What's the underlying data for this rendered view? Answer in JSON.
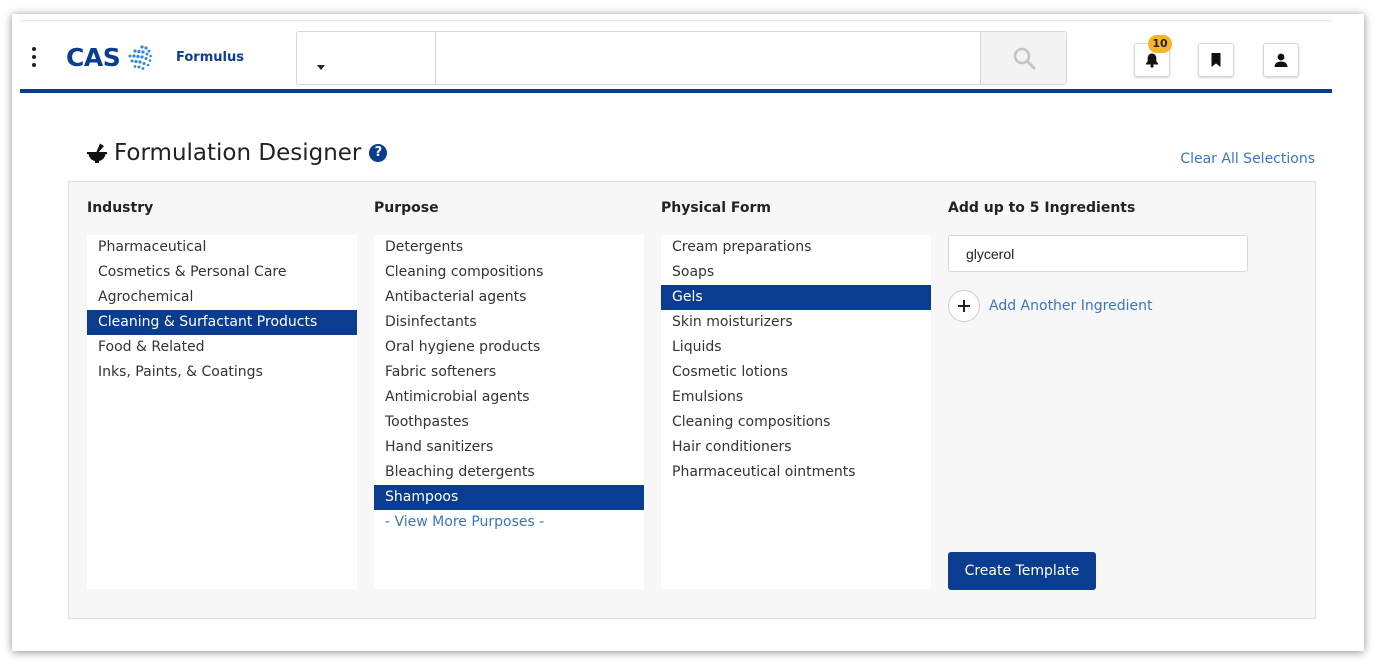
{
  "header": {
    "logo_text": "CAS",
    "product_name": "Formulus",
    "search": {
      "scope_value": "",
      "query": "",
      "placeholder": ""
    },
    "notifications_count": "10",
    "icons": [
      "menu-kebab-icon",
      "search-icon",
      "bell-icon",
      "bookmark-icon",
      "user-icon"
    ],
    "accent_color": "#0a3d8f",
    "badge_color": "#f5b52a"
  },
  "page": {
    "title": "Formulation Designer",
    "help_glyph": "?",
    "clear_all_label": "Clear All Selections"
  },
  "columns": {
    "industry": {
      "heading": "Industry",
      "items": [
        {
          "label": "Pharmaceutical",
          "selected": false
        },
        {
          "label": "Cosmetics & Personal Care",
          "selected": false
        },
        {
          "label": "Agrochemical",
          "selected": false
        },
        {
          "label": "Cleaning & Surfactant Products",
          "selected": true
        },
        {
          "label": "Food & Related",
          "selected": false
        },
        {
          "label": "Inks, Paints, & Coatings",
          "selected": false
        }
      ]
    },
    "purpose": {
      "heading": "Purpose",
      "items": [
        {
          "label": "Detergents",
          "selected": false
        },
        {
          "label": "Cleaning compositions",
          "selected": false
        },
        {
          "label": "Antibacterial agents",
          "selected": false
        },
        {
          "label": "Disinfectants",
          "selected": false
        },
        {
          "label": "Oral hygiene products",
          "selected": false
        },
        {
          "label": "Fabric softeners",
          "selected": false
        },
        {
          "label": "Antimicrobial agents",
          "selected": false
        },
        {
          "label": "Toothpastes",
          "selected": false
        },
        {
          "label": "Hand sanitizers",
          "selected": false
        },
        {
          "label": "Bleaching detergents",
          "selected": false
        },
        {
          "label": "Shampoos",
          "selected": true
        }
      ],
      "view_more_label": "- View More Purposes -"
    },
    "physical_form": {
      "heading": "Physical Form",
      "items": [
        {
          "label": "Cream preparations",
          "selected": false
        },
        {
          "label": "Soaps",
          "selected": false
        },
        {
          "label": "Gels",
          "selected": true
        },
        {
          "label": "Skin moisturizers",
          "selected": false
        },
        {
          "label": "Liquids",
          "selected": false
        },
        {
          "label": "Cosmetic lotions",
          "selected": false
        },
        {
          "label": "Emulsions",
          "selected": false
        },
        {
          "label": "Cleaning compositions",
          "selected": false
        },
        {
          "label": "Hair conditioners",
          "selected": false
        },
        {
          "label": "Pharmaceutical ointments",
          "selected": false
        }
      ]
    },
    "ingredients": {
      "heading": "Add up to 5 Ingredients",
      "values": [
        "glycerol"
      ],
      "add_label": "Add Another Ingredient",
      "create_label": "Create Template"
    }
  }
}
